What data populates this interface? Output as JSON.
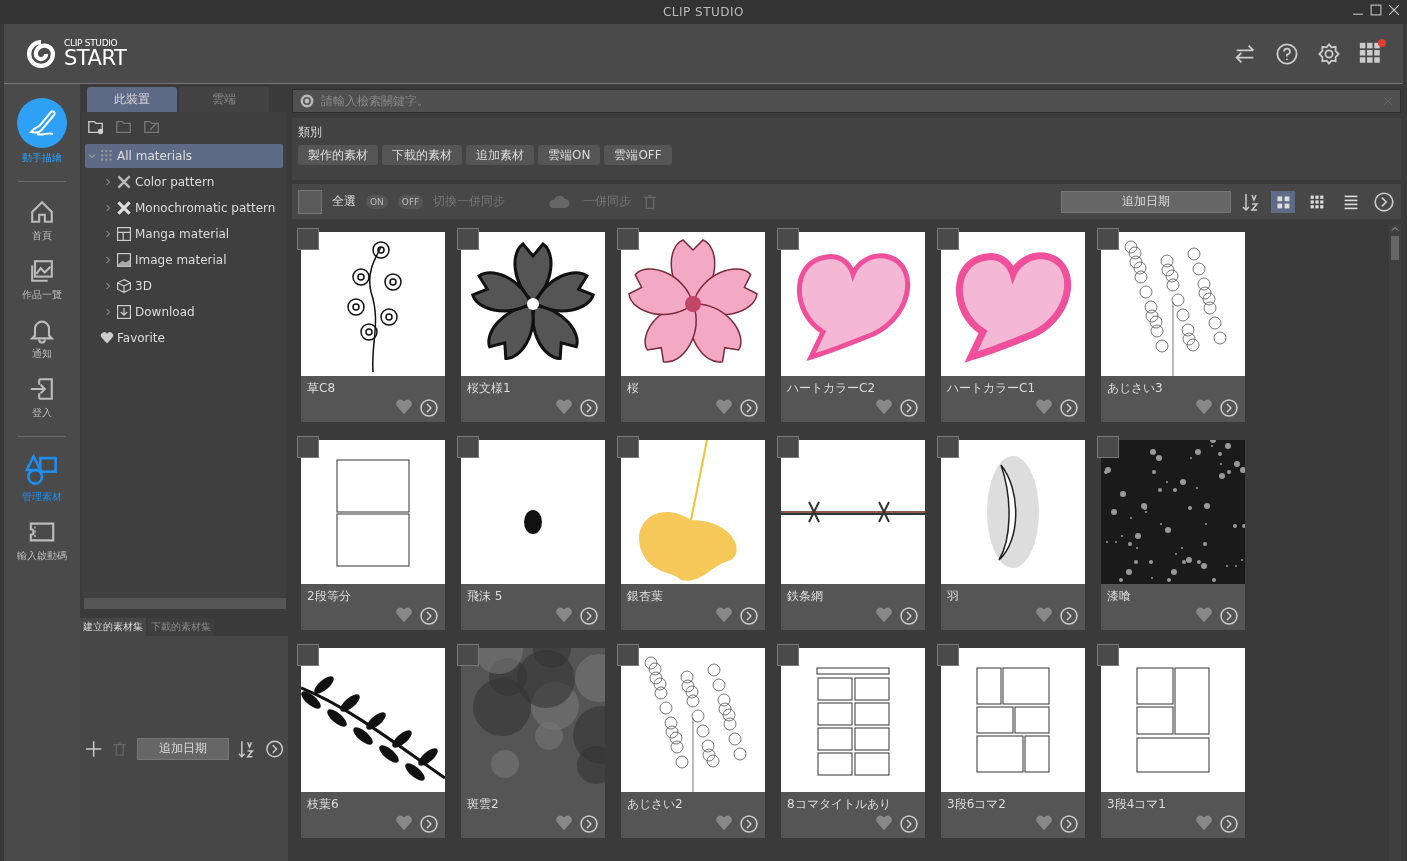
{
  "window": {
    "title": "CLIP STUDIO"
  },
  "header": {
    "brand_small": "CLIP STUDIO",
    "brand_large": "START",
    "notification_dot": true
  },
  "nav": [
    {
      "label": "動手描繪",
      "kind": "draw",
      "selected": false,
      "accent": true
    },
    {
      "label": "首頁",
      "kind": "home",
      "selected": false
    },
    {
      "label": "作品一覽",
      "kind": "works",
      "selected": false
    },
    {
      "label": "通知",
      "kind": "bell",
      "selected": false
    },
    {
      "label": "登入",
      "kind": "login",
      "selected": false
    },
    {
      "label": "管理素材",
      "kind": "shapes",
      "selected": true
    },
    {
      "label": "輸入啟動碼",
      "kind": "ticket",
      "selected": false
    }
  ],
  "source_tabs": [
    {
      "label": "此裝置",
      "selected": true
    },
    {
      "label": "雲端",
      "selected": false
    }
  ],
  "tree": [
    {
      "label": "All materials",
      "kind": "grid",
      "expanded": true,
      "selected": true,
      "children": [
        {
          "label": "Color pattern",
          "kind": "pattern",
          "expanded": false,
          "selected": false
        },
        {
          "label": "Monochromatic pattern",
          "kind": "mono",
          "expanded": false,
          "selected": false
        },
        {
          "label": "Manga material",
          "kind": "manga",
          "expanded": false,
          "selected": false
        },
        {
          "label": "Image material",
          "kind": "image",
          "expanded": false,
          "selected": false
        },
        {
          "label": "3D",
          "kind": "cube",
          "expanded": false,
          "selected": false
        },
        {
          "label": "Download",
          "kind": "download",
          "expanded": false,
          "selected": false
        }
      ]
    },
    {
      "label": "Favorite",
      "kind": "heart",
      "selected": false
    }
  ],
  "set_tabs": [
    {
      "label": "建立的素材集",
      "selected": true
    },
    {
      "label": "下載的素材集",
      "selected": false
    }
  ],
  "set_sort": "追加日期",
  "search": {
    "placeholder": "請輸入檢索關鍵字。"
  },
  "category": {
    "title": "類別",
    "chips": [
      "製作的素材",
      "下載的素材",
      "追加素材",
      "雲端ON",
      "雲端OFF"
    ]
  },
  "toolbar": {
    "select_all": "全選",
    "select_all_checked": false,
    "toggle_on": "ON",
    "toggle_off": "OFF",
    "sync_toggle": "切換一併同步",
    "sync": "一併同步",
    "sort": "追加日期",
    "views": [
      {
        "kind": "large",
        "selected": true
      },
      {
        "kind": "small",
        "selected": false
      },
      {
        "kind": "list",
        "selected": false
      }
    ]
  },
  "materials": [
    {
      "name": "草C8",
      "kind": "flower-line",
      "checked": false
    },
    {
      "name": "桜文様1",
      "kind": "sakura-pattern",
      "checked": false
    },
    {
      "name": "桜",
      "kind": "sakura",
      "checked": false
    },
    {
      "name": "ハートカラーC2",
      "kind": "heart",
      "checked": false
    },
    {
      "name": "ハートカラーC1",
      "kind": "heart",
      "checked": false
    },
    {
      "name": "あじさい3",
      "kind": "hydrangea",
      "checked": false
    },
    {
      "name": "2段等分",
      "kind": "frames2",
      "checked": false
    },
    {
      "name": "飛沫 5",
      "kind": "splash",
      "checked": false
    },
    {
      "name": "銀杏葉",
      "kind": "ginkgo",
      "checked": false
    },
    {
      "name": "鉄条網",
      "kind": "wire",
      "checked": false
    },
    {
      "name": "羽",
      "kind": "feather",
      "checked": false
    },
    {
      "name": "漆喰",
      "kind": "noise",
      "checked": false
    },
    {
      "name": "枝葉6",
      "kind": "leaves",
      "checked": false
    },
    {
      "name": "斑雲2",
      "kind": "clouds",
      "checked": false
    },
    {
      "name": "あじさい2",
      "kind": "hydrangea",
      "checked": false
    },
    {
      "name": "8コマタイトルあり",
      "kind": "frames8",
      "checked": false
    },
    {
      "name": "3段6コマ2",
      "kind": "frames6",
      "checked": false
    },
    {
      "name": "3段4コマ1",
      "kind": "frames4",
      "checked": false
    }
  ]
}
